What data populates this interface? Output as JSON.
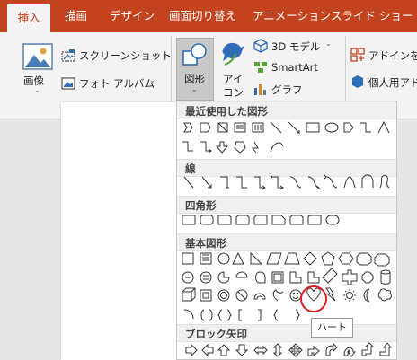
{
  "tabs": [
    "挿入",
    "描画",
    "デザイン",
    "画面切り替え",
    "アニメーション",
    "スライド ショー"
  ],
  "active_tab": "挿入",
  "ribbon": {
    "image_label": "画像",
    "screenshot_label": "スクリーンショット",
    "photo_album_label": "フォト アルバム",
    "group_images": "画像",
    "shapes_label": "図形",
    "icons_label_1": "アイ",
    "icons_label_2": "コン",
    "model3d_label": "3D モデル",
    "smartart_label": "SmartArt",
    "graph_label": "グラフ",
    "addin_label": "アドインを入",
    "personal_label": "個人用アド"
  },
  "dropdown": {
    "sections": [
      "最近使用した図形",
      "線",
      "四角形",
      "基本図形",
      "ブロック矢印"
    ],
    "tooltip": "ハート"
  },
  "colors": {
    "accent": "#c4431f",
    "highlight": "#e01b1b"
  }
}
